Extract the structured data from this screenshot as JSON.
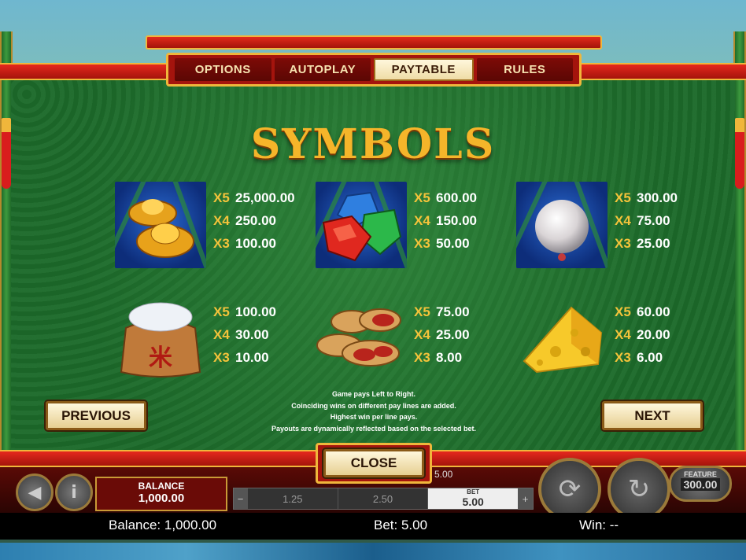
{
  "tabs": [
    {
      "label": "OPTIONS",
      "active": false
    },
    {
      "label": "AUTOPLAY",
      "active": false
    },
    {
      "label": "PAYTABLE",
      "active": true
    },
    {
      "label": "RULES",
      "active": false
    }
  ],
  "title": "SYMBOLS",
  "symbols": [
    {
      "icon": "gold-ingot-icon",
      "pays": [
        {
          "mult": "X5",
          "value": "25,000.00"
        },
        {
          "mult": "X4",
          "value": "250.00"
        },
        {
          "mult": "X3",
          "value": "100.00"
        }
      ]
    },
    {
      "icon": "gems-icon",
      "pays": [
        {
          "mult": "X5",
          "value": "600.00"
        },
        {
          "mult": "X4",
          "value": "150.00"
        },
        {
          "mult": "X3",
          "value": "50.00"
        }
      ]
    },
    {
      "icon": "pearl-icon",
      "pays": [
        {
          "mult": "X5",
          "value": "300.00"
        },
        {
          "mult": "X4",
          "value": "75.00"
        },
        {
          "mult": "X3",
          "value": "25.00"
        }
      ]
    },
    {
      "icon": "rice-sack-icon",
      "pays": [
        {
          "mult": "X5",
          "value": "100.00"
        },
        {
          "mult": "X4",
          "value": "30.00"
        },
        {
          "mult": "X3",
          "value": "10.00"
        }
      ]
    },
    {
      "icon": "peanuts-icon",
      "pays": [
        {
          "mult": "X5",
          "value": "75.00"
        },
        {
          "mult": "X4",
          "value": "25.00"
        },
        {
          "mult": "X3",
          "value": "8.00"
        }
      ]
    },
    {
      "icon": "cheese-icon",
      "pays": [
        {
          "mult": "X5",
          "value": "60.00"
        },
        {
          "mult": "X4",
          "value": "20.00"
        },
        {
          "mult": "X3",
          "value": "6.00"
        }
      ]
    }
  ],
  "info": [
    "Game pays Left to Right.",
    "Coinciding wins on different pay lines are added.",
    "Highest win per line pays.",
    "Payouts are dynamically reflected based on the selected bet."
  ],
  "buttons": {
    "previous": "PREVIOUS",
    "next": "NEXT",
    "close": "CLOSE"
  },
  "console": {
    "balance_label": "BALANCE",
    "balance_value": "1,000.00",
    "bet_options": [
      "1.25",
      "2.50"
    ],
    "bet_label": "BET",
    "bet_value": "5.00",
    "top_bet": "5.00",
    "feature_label": "FEATURE",
    "feature_value": "300.00"
  },
  "status": {
    "balance": "Balance: 1,000.00",
    "bet": "Bet: 5.00",
    "win": "Win: --"
  }
}
